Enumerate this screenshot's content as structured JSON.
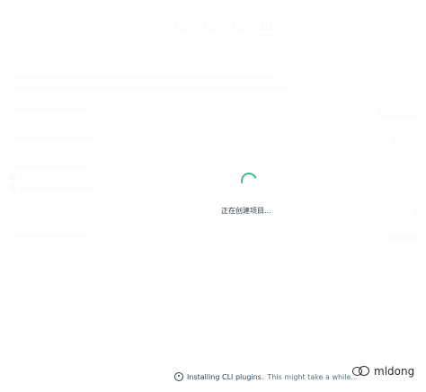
{
  "overlay": {
    "loading_text": "正在创建项目...",
    "status": {
      "primary": "Installing CLI plugins.",
      "secondary": "This might take a while..."
    },
    "watermark_text": "mldong"
  },
  "colors": {
    "accent": "#42b983",
    "text_dark": "#2c3e50"
  }
}
